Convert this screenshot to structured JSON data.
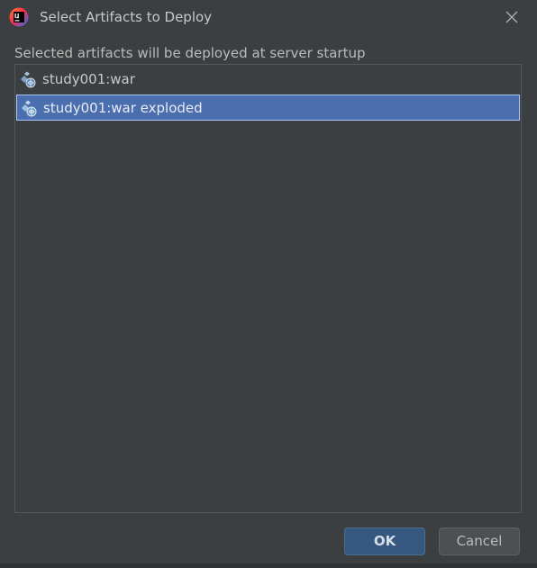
{
  "dialog": {
    "title": "Select Artifacts to Deploy",
    "subtitle": "Selected artifacts will be deployed at server startup",
    "app_icon": "intellij-idea-icon",
    "close_icon": "close-icon"
  },
  "artifacts": {
    "items": [
      {
        "label": "study001:war",
        "icon": "war-artifact-icon",
        "selected": false
      },
      {
        "label": "study001:war exploded",
        "icon": "war-artifact-icon",
        "selected": true
      }
    ]
  },
  "buttons": {
    "ok_label": "OK",
    "cancel_label": "Cancel"
  },
  "colors": {
    "background": "#3c3f41",
    "selection": "#4b6eaf",
    "primary_button": "#365880"
  }
}
